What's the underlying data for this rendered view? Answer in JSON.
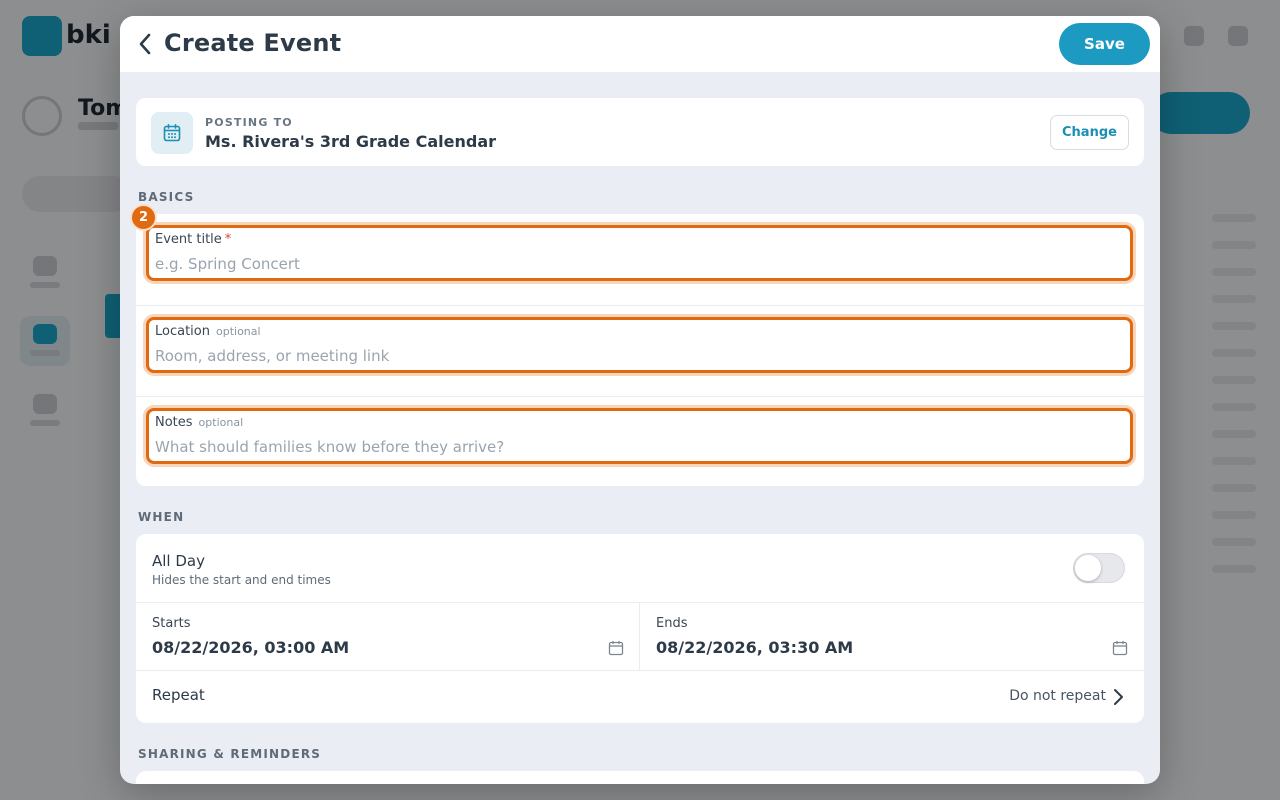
{
  "background": {
    "app_name": "bki",
    "page_title": "Tom"
  },
  "modal": {
    "title": "Create Event",
    "save_label": "Save",
    "posting": {
      "label": "POSTING TO",
      "calendar_name": "Ms. Rivera's 3rd Grade Calendar",
      "change_label": "Change",
      "icon": "calendar-icon"
    },
    "basics": {
      "section_label": "BASICS",
      "step_number": "2",
      "fields": [
        {
          "label": "Event title",
          "required_mark": "*",
          "optional_mark": "",
          "placeholder": "e.g. Spring Concert",
          "value": ""
        },
        {
          "label": "Location",
          "required_mark": "",
          "optional_mark": "optional",
          "placeholder": "Room, address, or meeting link",
          "value": ""
        },
        {
          "label": "Notes",
          "required_mark": "",
          "optional_mark": "optional",
          "placeholder": "What should families know before they arrive?",
          "value": ""
        }
      ]
    },
    "when": {
      "section_label": "WHEN",
      "all_day": {
        "title": "All Day",
        "subtitle": "Hides the start and end times",
        "enabled": false
      },
      "starts": {
        "label": "Starts",
        "value": "08/22/2026, 03:00 AM"
      },
      "ends": {
        "label": "Ends",
        "value": "08/22/2026, 03:30 AM"
      },
      "repeat": {
        "label": "Repeat",
        "value": "Do not repeat"
      }
    },
    "sharing": {
      "section_label": "SHARING & REMINDERS"
    }
  },
  "colors": {
    "accent": "#1c9ac2",
    "highlight": "#e06a12",
    "highlight_glow": "#f9d5bc",
    "modal_bg": "#eaeef4"
  }
}
